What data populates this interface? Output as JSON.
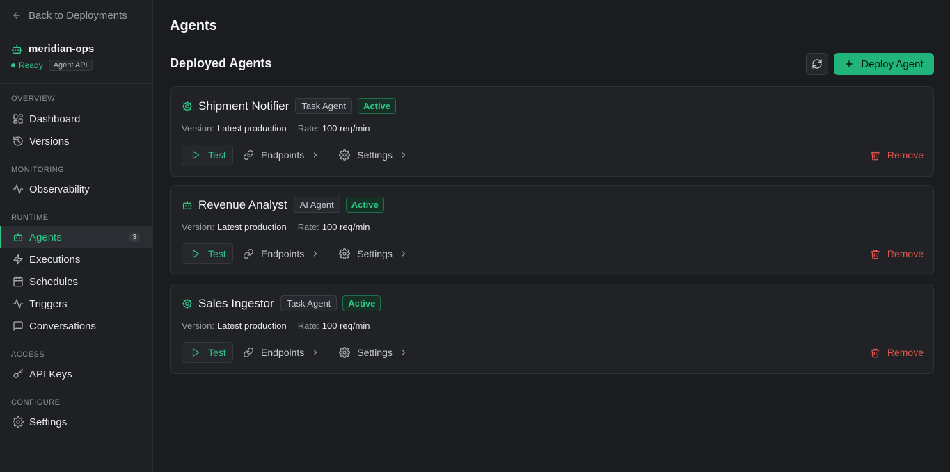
{
  "sidebar": {
    "back_label": "Back to Deployments",
    "project": {
      "name": "meridian-ops",
      "status": "Ready",
      "badge": "Agent API"
    },
    "sections": [
      {
        "label": "OVERVIEW",
        "items": [
          {
            "label": "Dashboard",
            "icon": "dashboard-icon"
          },
          {
            "label": "Versions",
            "icon": "history-icon"
          }
        ]
      },
      {
        "label": "MONITORING",
        "items": [
          {
            "label": "Observability",
            "icon": "activity-icon"
          }
        ]
      },
      {
        "label": "RUNTIME",
        "items": [
          {
            "label": "Agents",
            "icon": "bot-icon",
            "count": "3",
            "active": true
          },
          {
            "label": "Executions",
            "icon": "lightning-icon"
          },
          {
            "label": "Schedules",
            "icon": "calendar-icon"
          },
          {
            "label": "Triggers",
            "icon": "activity-icon"
          },
          {
            "label": "Conversations",
            "icon": "message-icon"
          }
        ]
      },
      {
        "label": "ACCESS",
        "items": [
          {
            "label": "API Keys",
            "icon": "key-icon"
          }
        ]
      },
      {
        "label": "CONFIGURE",
        "items": [
          {
            "label": "Settings",
            "icon": "gear-icon"
          }
        ]
      }
    ]
  },
  "main": {
    "page_title": "Agents",
    "section_title": "Deployed Agents",
    "deploy_label": "Deploy Agent",
    "labels": {
      "version": "Version:",
      "rate": "Rate:",
      "test": "Test",
      "endpoints": "Endpoints",
      "settings": "Settings",
      "remove": "Remove"
    },
    "agents": [
      {
        "name": "Shipment Notifier",
        "type": "Task Agent",
        "status": "Active",
        "version": "Latest production",
        "rate": "100 req/min",
        "icon": "cog-icon"
      },
      {
        "name": "Revenue Analyst",
        "type": "AI Agent",
        "status": "Active",
        "version": "Latest production",
        "rate": "100 req/min",
        "icon": "bot-icon"
      },
      {
        "name": "Sales Ingestor",
        "type": "Task Agent",
        "status": "Active",
        "version": "Latest production",
        "rate": "100 req/min",
        "icon": "cog-icon"
      }
    ]
  },
  "colors": {
    "accent": "#2fc889",
    "danger": "#e2574c",
    "background": "#1b1c20"
  }
}
